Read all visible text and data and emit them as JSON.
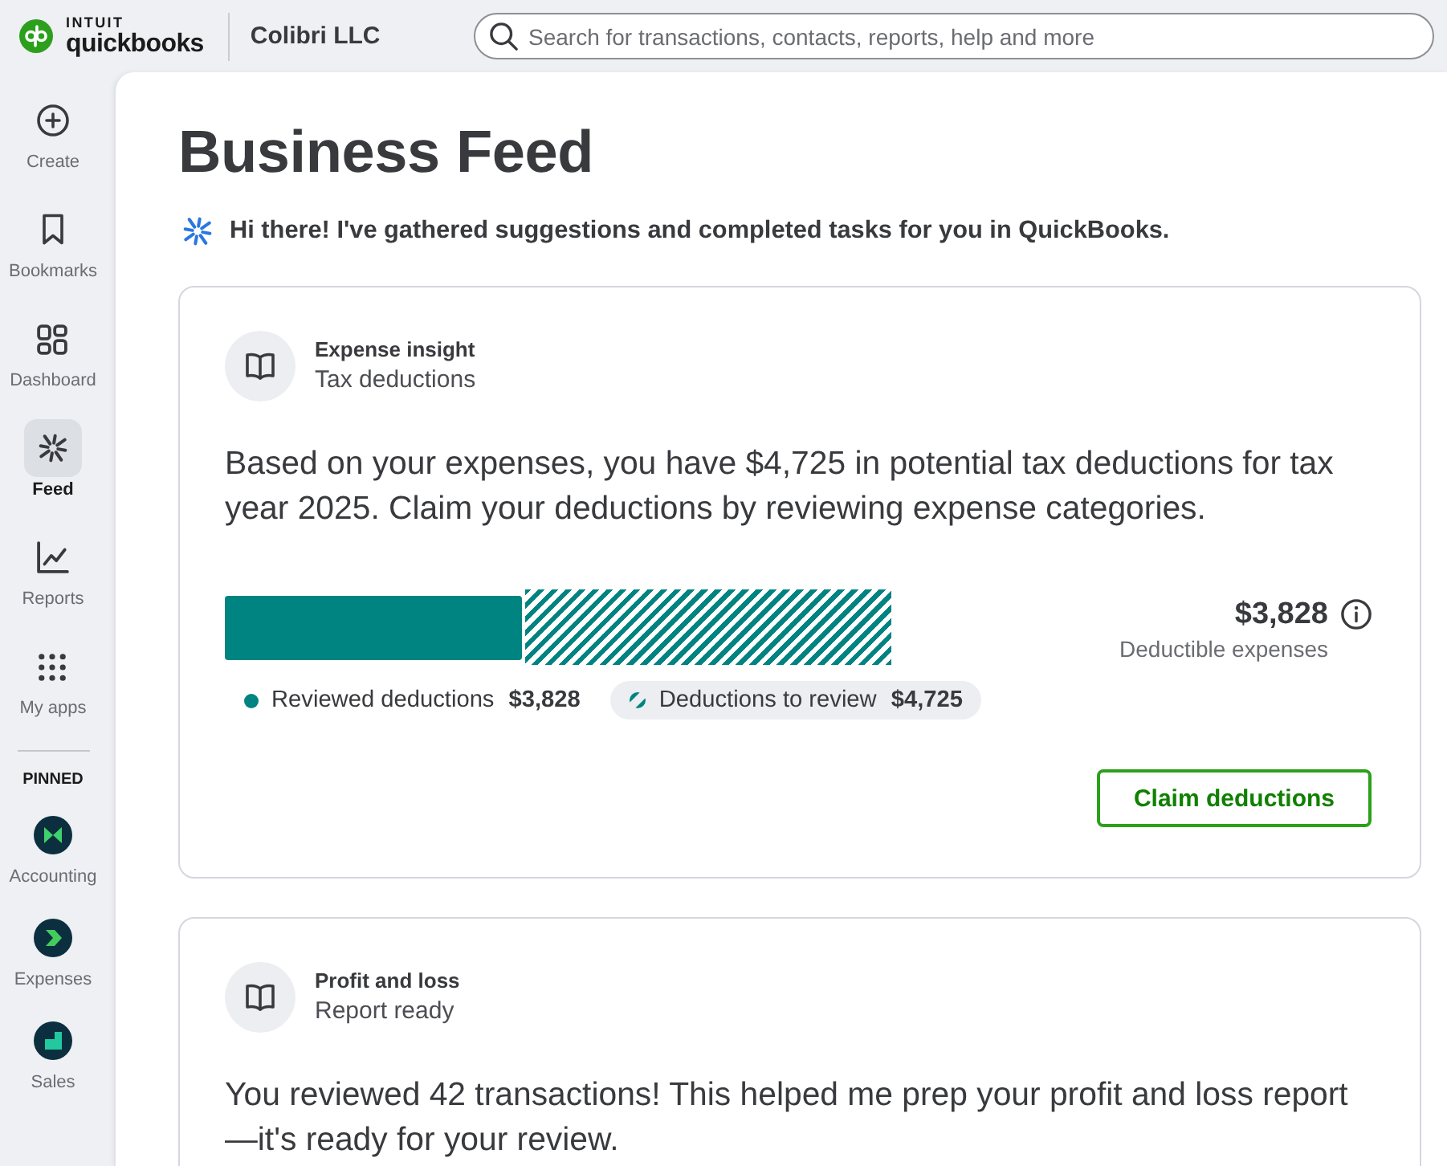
{
  "top_bar": {
    "logo": {
      "overline": "INTUIT",
      "wordmark": "quickbooks"
    },
    "company": "Colibri LLC",
    "search": {
      "placeholder": "Search for transactions, contacts, reports, help and more"
    }
  },
  "sidebar": {
    "items": [
      {
        "kind": "create",
        "label": "Create",
        "selected": false
      },
      {
        "kind": "bookmarks",
        "label": "Bookmarks",
        "selected": false
      },
      {
        "kind": "dashboard",
        "label": "Dashboard",
        "selected": false
      },
      {
        "kind": "feed",
        "label": "Feed",
        "selected": true
      },
      {
        "kind": "reports",
        "label": "Reports",
        "selected": false
      },
      {
        "kind": "apps",
        "label": "My apps",
        "selected": false
      }
    ],
    "pinned_heading": "PINNED",
    "pinned": [
      {
        "kind": "accounting",
        "label": "Accounting"
      },
      {
        "kind": "expenses",
        "label": "Expenses"
      },
      {
        "kind": "sales",
        "label": "Sales"
      }
    ]
  },
  "page": {
    "title": "Business Feed",
    "greeting": "Hi there! I've gathered suggestions and completed tasks for you in QuickBooks."
  },
  "cards": [
    {
      "kind": "deductions",
      "category": "Expense insight",
      "subtitle": "Tax deductions",
      "body": "Based on your expenses, you have $4,725 in potential tax deductions for tax year 2025. Claim your deductions by reviewing expense categories.",
      "meter": {
        "level": 0.446
      },
      "total": "$3,828",
      "total_label": "Deductible expenses",
      "legend": [
        {
          "kind": "solid",
          "label": "Reviewed deductions",
          "amount": "$3,828",
          "selected": false
        },
        {
          "kind": "hatched",
          "label": "Deductions to review",
          "amount": "$4,725",
          "selected": true
        }
      ],
      "button": "Claim deductions"
    },
    {
      "kind": "report",
      "category": "Profit and loss",
      "subtitle": "Report ready",
      "body": "You reviewed 42 transactions! This helped me prep your profit and loss report—it's ready for your review."
    }
  ]
}
